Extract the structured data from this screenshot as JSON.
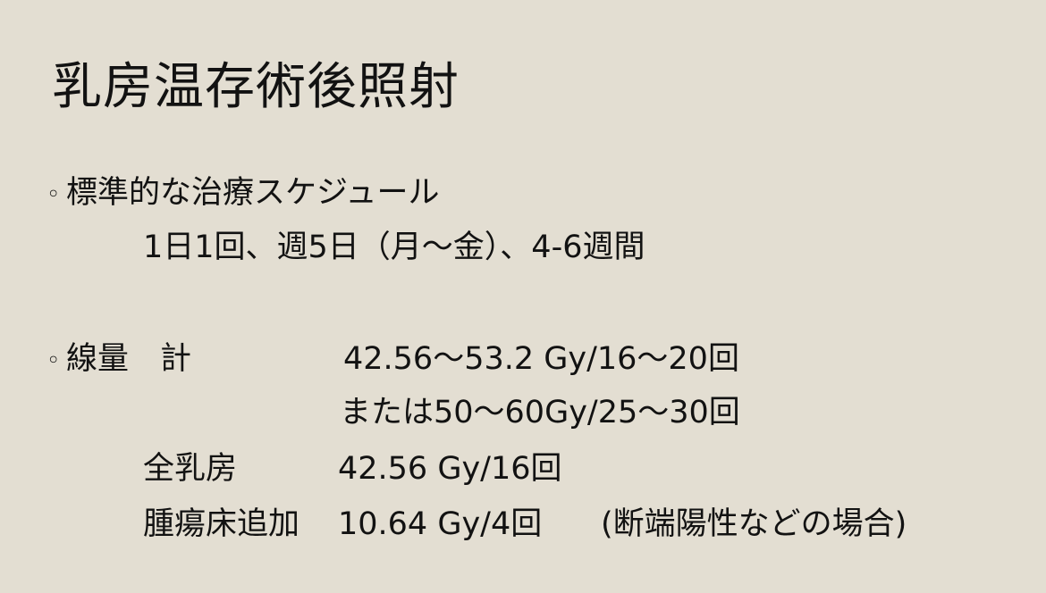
{
  "slide": {
    "title": "乳房温存術後照射",
    "bullet_mark": "◦",
    "schedule": {
      "heading": "標準的な治療スケジュール",
      "detail": "1日1回、週5日（月～金）、4-6週間"
    },
    "dose": {
      "label": "線量　計",
      "total_primary": "42.56～53.2 Gy/16～20回",
      "total_alternative": "または50～60Gy/25～30回",
      "whole_breast_label": "全乳房",
      "whole_breast_value": "42.56 Gy/16回",
      "boost_label": "腫瘍床追加",
      "boost_value": "10.64 Gy/4回",
      "boost_note": "(断端陽性などの場合)"
    }
  }
}
